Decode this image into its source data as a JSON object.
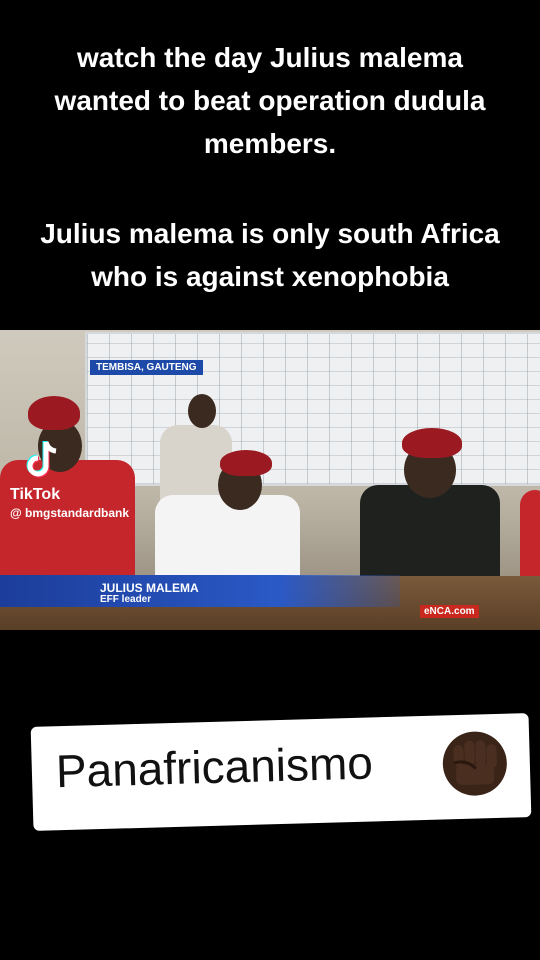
{
  "caption": {
    "line1": "watch the day Julius malema",
    "line2": "wanted to beat operation dudula",
    "line3": "members.",
    "line4": "Julius malema is only south Africa",
    "line5": "who is against xenophobia"
  },
  "video": {
    "location": "TEMBISA, GAUTENG",
    "name": "JULIUS MALEMA",
    "role": "EFF leader",
    "channel": "eNCA.com"
  },
  "tiktok": {
    "brand": "TikTok",
    "handle": "@ bmgstandardbank",
    "icon": "tiktok-logo-icon"
  },
  "sticker": {
    "text": "Panafricanismo",
    "emoji_icon": "raised-fist-icon"
  },
  "colors": {
    "background": "#000000",
    "caption_text": "#ffffff",
    "lower_third": "#1c3d9a",
    "beret": "#9b1a22",
    "sticker_bg": "#ffffff"
  }
}
